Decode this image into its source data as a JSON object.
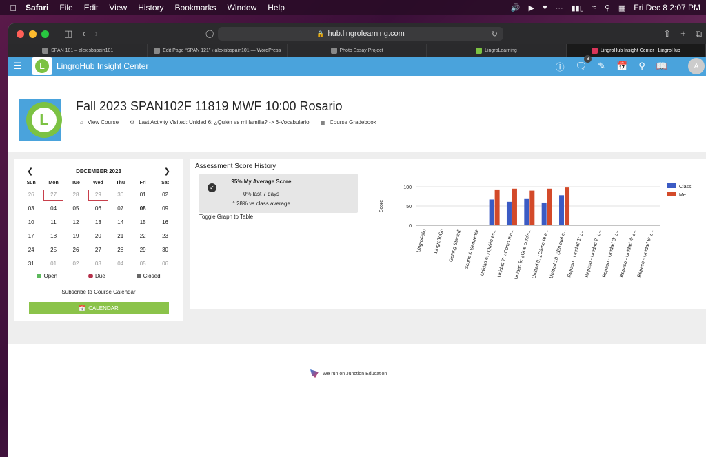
{
  "menubar": {
    "items": [
      "Safari",
      "File",
      "Edit",
      "View",
      "History",
      "Bookmarks",
      "Window",
      "Help"
    ],
    "datetime": "Fri Dec 8  2:07 PM"
  },
  "browser": {
    "url": "hub.lingrolearning.com",
    "tabs": [
      {
        "label": "SPAN 101 – alexisbspain101"
      },
      {
        "label": "Edit Page “SPAN 121” ‹ alexisbspain101 — WordPress"
      },
      {
        "label": "Photo Essay Project"
      },
      {
        "label": "LingroLearning"
      },
      {
        "label": "LingroHub Insight Center | LingroHub"
      }
    ]
  },
  "app": {
    "name": "LingroHub Insight Center",
    "notification_count": "3",
    "avatar_initial": "A"
  },
  "course": {
    "title": "Fall 2023 SPAN102F 11819 MWF 10:00 Rosario",
    "view_course": "View Course",
    "last_activity": "Last Activity Visited: Unidad 6: ¿Quién es mi familia?  ->  6-Vocabulario",
    "gradebook": "Course Gradebook"
  },
  "calendar": {
    "month": "DECEMBER 2023",
    "dow": [
      "Sun",
      "Mon",
      "Tue",
      "Wed",
      "Thu",
      "Fri",
      "Sat"
    ],
    "legend_open": "Open",
    "legend_due": "Due",
    "legend_closed": "Closed",
    "subscribe": "Subscribe to Course Calendar",
    "button": "CALENDAR"
  },
  "assessment": {
    "title": "Assessment Score History",
    "average": "95% My Average Score",
    "last7": "0% last 7 days",
    "vs_class": "^ 28% vs class average",
    "toggle": "Toggle Graph to Table"
  },
  "chart_data": {
    "type": "bar",
    "ylabel": "Score",
    "ylim": [
      0,
      100
    ],
    "yticks": [
      0,
      50,
      100
    ],
    "categories": [
      "LingroFolio",
      "LingroToGo",
      "Getting Started!",
      "Scope & Sequence",
      "Unidad 6: ¿Quién es...",
      "Unidad 7: ¿Cómo ma...",
      "Unidad 8: ¿Qué comis...",
      "Unidad 9: ¿Cómo te e...",
      "Unidad 10: ¿En qué e...",
      "Repaso - Unidad 1: ¿...",
      "Repaso - Unidad 2: ¿...",
      "Repaso - Unidad 3: ¿...",
      "Repaso - Unidad 4: ¿...",
      "Repaso - Unidad 5: ¿..."
    ],
    "series": [
      {
        "name": "Class",
        "color": "#3b5bc4",
        "values": [
          null,
          null,
          null,
          null,
          67,
          61,
          70,
          59,
          78,
          null,
          null,
          null,
          null,
          null
        ]
      },
      {
        "name": "Me",
        "color": "#d34a2a",
        "values": [
          null,
          null,
          null,
          null,
          93,
          95,
          90,
          95,
          98,
          null,
          null,
          null,
          null,
          null
        ]
      }
    ]
  },
  "footer": {
    "powered": "We run on Junction Education"
  }
}
